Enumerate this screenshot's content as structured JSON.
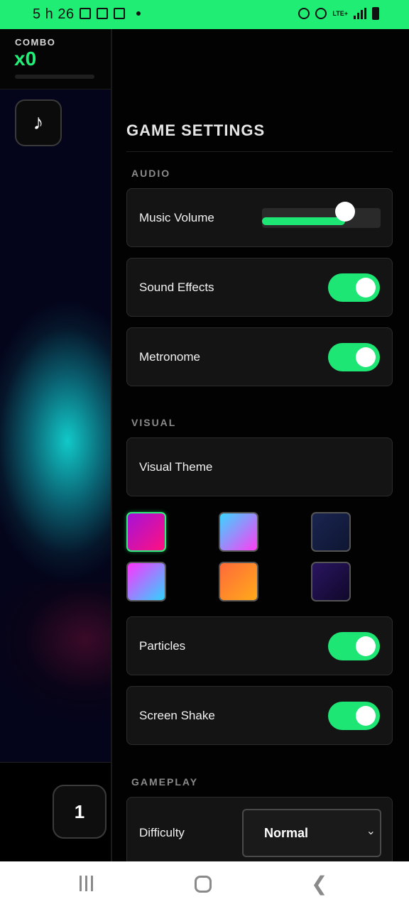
{
  "status_bar": {
    "time": "5 h 26",
    "icons": [
      "sd-card-icon",
      "image-icon",
      "screenshot-icon",
      "dot-icon",
      "alarm-icon",
      "hotspot-icon",
      "lte-icon",
      "signal-icon",
      "battery-icon"
    ],
    "lte_label": "LTE+"
  },
  "game": {
    "combo_label": "COMBO",
    "combo_value": "x0",
    "level": "1",
    "accent": "#22ef7a"
  },
  "settings": {
    "title": "GAME SETTINGS",
    "audio": {
      "heading": "AUDIO",
      "music_volume_label": "Music Volume",
      "music_volume_fraction": 0.7,
      "sound_effects_label": "Sound Effects",
      "sound_effects_on": true,
      "metronome_label": "Metronome",
      "metronome_on": true
    },
    "visual": {
      "heading": "VISUAL",
      "theme_label": "Visual Theme",
      "themes": [
        {
          "name": "magenta",
          "colors": [
            "#a512d8",
            "#ff1180"
          ],
          "selected": true
        },
        {
          "name": "pastel-cyan",
          "colors": [
            "#3ad6ff",
            "#ff3df5"
          ],
          "selected": false
        },
        {
          "name": "navy",
          "colors": [
            "#1a2550",
            "#0e1632"
          ],
          "selected": false
        },
        {
          "name": "violet-cyan",
          "colors": [
            "#ff33ff",
            "#2fd4ff"
          ],
          "selected": false
        },
        {
          "name": "orange",
          "colors": [
            "#ff6a3a",
            "#ffaa1a"
          ],
          "selected": false
        },
        {
          "name": "deep-purple",
          "colors": [
            "#2a1560",
            "#10082a"
          ],
          "selected": false
        }
      ],
      "particles_label": "Particles",
      "particles_on": true,
      "screen_shake_label": "Screen Shake",
      "screen_shake_on": true
    },
    "gameplay": {
      "heading": "GAMEPLAY",
      "difficulty_label": "Difficulty",
      "difficulty_value": "Normal"
    }
  },
  "nav": {
    "buttons": [
      "recents-icon",
      "home-icon",
      "back-icon"
    ]
  }
}
